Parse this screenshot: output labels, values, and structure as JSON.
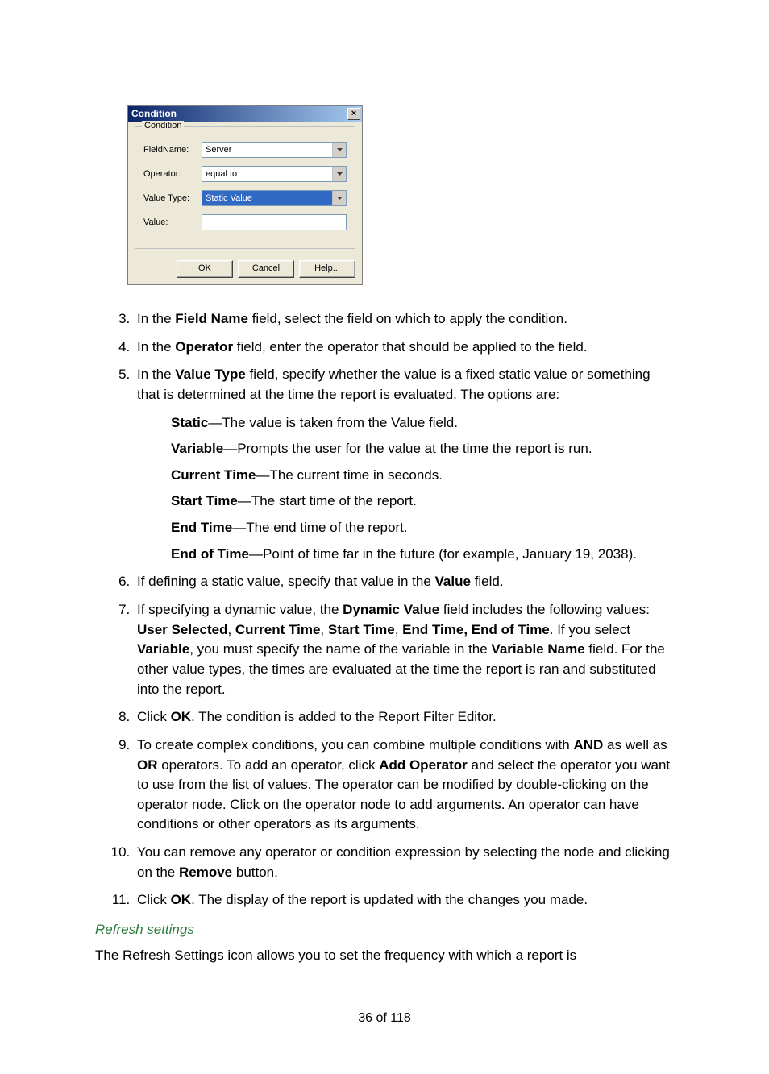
{
  "dialog": {
    "title": "Condition",
    "group_label": "Condition",
    "fields": {
      "fieldname_label": "FieldName:",
      "fieldname_value": "Server",
      "operator_label": "Operator:",
      "operator_value": "equal to",
      "valuetype_label": "Value Type:",
      "valuetype_value": "Static Value",
      "value_label": "Value:",
      "value_value": ""
    },
    "buttons": {
      "ok": "OK",
      "cancel": "Cancel",
      "help": "Help..."
    },
    "close_glyph": "×"
  },
  "steps": {
    "s3_a": "In the ",
    "s3_b": "Field Name",
    "s3_c": " field, select the field on which to apply the condition.",
    "s4_a": "In the ",
    "s4_b": "Operator",
    "s4_c": " field, enter the operator that should be applied to the field.",
    "s5_a": "In the ",
    "s5_b": "Value Type",
    "s5_c": " field, specify whether the value is a fixed static value or something that is determined at the time the report is evaluated. The options are:",
    "opts": {
      "o1_b": "Static",
      "o1_t": "—The value is taken from the Value field.",
      "o2_b": "Variable",
      "o2_t": "—Prompts the user for the value at the time the report is run.",
      "o3_b": "Current Time",
      "o3_t": "—The current time in seconds.",
      "o4_b": "Start Time",
      "o4_t": "—The start time of the report.",
      "o5_b": "End Time",
      "o5_t": "—The end time of the report.",
      "o6_b": "End of Time",
      "o6_t": "—Point of time far in the future (for example, January 19, 2038)."
    },
    "s6_a": "If defining a static value, specify that value in the ",
    "s6_b": "Value",
    "s6_c": " field.",
    "s7_a": "If specifying a dynamic value, the ",
    "s7_b": "Dynamic Value",
    "s7_c": " field includes the following values: ",
    "s7_d": "User Selected",
    "s7_e": ", ",
    "s7_f": "Current Time",
    "s7_g": ", ",
    "s7_h": "Start Time",
    "s7_i": ", ",
    "s7_j": "End Time, End of Time",
    "s7_k": ". If you select ",
    "s7_l": "Variable",
    "s7_m": ", you must specify the name of the variable in the ",
    "s7_n": "Variable Name",
    "s7_o": " field. For the other value types, the times are evaluated at the time the report is ran and substituted into the report.",
    "s8_a": "Click ",
    "s8_b": "OK",
    "s8_c": ". The condition is added to the Report Filter Editor.",
    "s9_a": "To create complex conditions, you can combine multiple conditions with ",
    "s9_b": "AND",
    "s9_c": " as well as ",
    "s9_d": "OR",
    "s9_e": " operators. To add an operator, click ",
    "s9_f": "Add Operator",
    "s9_g": " and select the operator you want to use from the list of values. The operator can be modified by double-clicking on the operator node. Click on the operator node to add arguments. An operator can have conditions or other operators as its arguments.",
    "s10_a": "You can remove any operator or condition expression by selecting the node and clicking on the ",
    "s10_b": "Remove",
    "s10_c": " button.",
    "s11_a": "Click ",
    "s11_b": "OK",
    "s11_c": ". The display of the report is updated with the changes you made."
  },
  "heading": "Refresh settings",
  "para": "The Refresh Settings icon allows you to set the frequency with which a report is",
  "page_number": "36 of 118"
}
